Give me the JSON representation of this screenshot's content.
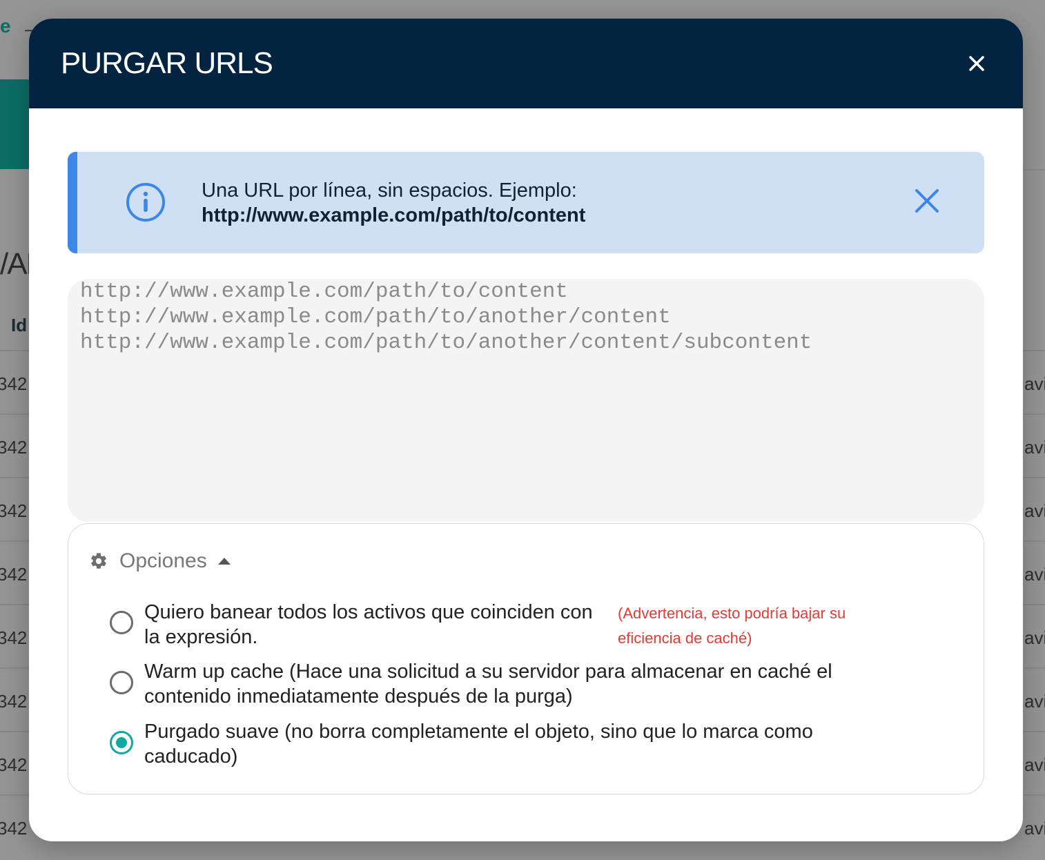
{
  "background": {
    "arrow_glyph": "→",
    "logo_fragment": "e",
    "heading_fragment": "/AL",
    "id_column_header": "Id",
    "rows": [
      {
        "id": "342",
        "right": "avi"
      },
      {
        "id": "342",
        "right": "avi"
      },
      {
        "id": "342",
        "right": "avi"
      },
      {
        "id": "342",
        "right": "avi"
      },
      {
        "id": "342",
        "right": "avi"
      },
      {
        "id": "342",
        "right": "avi"
      },
      {
        "id": "342",
        "right": "avi"
      },
      {
        "id": "342",
        "right": "avi"
      }
    ]
  },
  "modal": {
    "title": "PURGAR URLS",
    "close_icon": "close-icon",
    "alert": {
      "icon": "info-icon",
      "line1": "Una URL por línea, sin espacios. Ejemplo:",
      "line2": "http://www.example.com/path/to/content",
      "close_icon": "close-icon",
      "accent_color": "#3c86e5",
      "background_color": "#cfe0f5"
    },
    "url_input": {
      "value": "",
      "placeholder": "http://www.example.com/path/to/content\nhttp://www.example.com/path/to/another/content\nhttp://www.example.com/path/to/another/content/subcontent"
    },
    "options": {
      "label": "Opciones",
      "icon": "gear-icon",
      "expanded": true,
      "items": [
        {
          "label": "Quiero banear todos los activos que coinciden con la expresión.",
          "warning": "(Advertencia, esto podría bajar su eficiencia de caché)",
          "checked": false
        },
        {
          "label": "Warm up cache (Hace una solicitud a su servidor para almacenar en caché el contenido inmediatamente después de la purga)",
          "checked": false
        },
        {
          "label": "Purgado suave (no borra completamente el objeto, sino que lo marca como caducado)",
          "checked": true
        }
      ]
    },
    "header_color": "#022440",
    "radio_accent_color": "#12a8a0",
    "warning_color": "#e53935"
  }
}
